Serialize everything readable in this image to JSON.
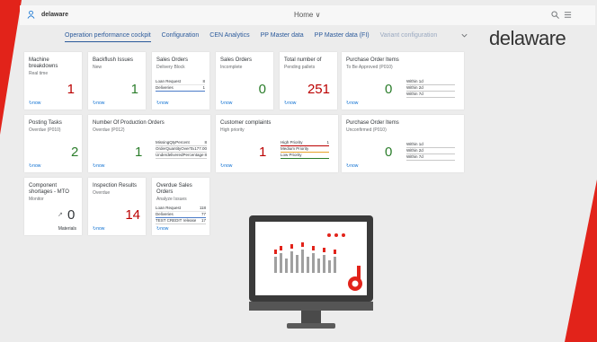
{
  "shell": {
    "brand": "delaware",
    "home_label": "Home ∨",
    "user_icon": "user-icon",
    "search_icon": "search-icon",
    "menu_icon": "menu-icon"
  },
  "tabs": [
    {
      "label": "Operation performance cockpit",
      "active": true
    },
    {
      "label": "Configuration",
      "active": false
    },
    {
      "label": "CEN Analytics",
      "active": false
    },
    {
      "label": "PP Master data",
      "active": false
    },
    {
      "label": "PP Master data (FI)",
      "active": false
    },
    {
      "label": "Variant configuration",
      "active": false
    }
  ],
  "logo": {
    "text": "delaware"
  },
  "colors": {
    "accent": "#e2231a",
    "link": "#0a6ed1",
    "negative": "#bb0000",
    "positive": "#2b7d2b"
  },
  "tiles": {
    "machine": {
      "title": "Machine breakdowns",
      "subtitle": "Real time",
      "value": "1",
      "footer": "now"
    },
    "backflush": {
      "title": "Backflush Issues",
      "subtitle": "New",
      "value": "1",
      "footer": "now"
    },
    "sales_block": {
      "title": "Sales Orders",
      "subtitle": "Delivery Block",
      "footer": "now",
      "rows": [
        {
          "label": "Loan Request",
          "value": "8"
        },
        {
          "label": "Deliveries",
          "value": "1"
        }
      ]
    },
    "sales_incomplete": {
      "title": "Sales Orders",
      "subtitle": "Incomplete",
      "value": "0",
      "footer": "now"
    },
    "pending": {
      "title": "Total number of",
      "subtitle": "Pending pallets",
      "value": "251",
      "footer": "now"
    },
    "po_approval": {
      "title": "Purchase Order Items",
      "subtitle": "To Be Approved (P010)",
      "value": "0",
      "footer": "now",
      "rows": [
        {
          "label": "Within 1d",
          "value": ""
        },
        {
          "label": "Within 2d",
          "value": ""
        },
        {
          "label": "Within 7d",
          "value": ""
        }
      ]
    },
    "posting": {
      "title": "Posting Tasks",
      "subtitle": "Overdue (P010)",
      "value": "2",
      "footer": "now"
    },
    "production": {
      "title": "Number Of Production Orders",
      "subtitle": "Overdue (P012)",
      "value": "1",
      "footer": "now",
      "rows": [
        {
          "label": "MissingQtyPercent",
          "value": "8"
        },
        {
          "label": "OrderQuantityOverTargetQty",
          "value": "177.00"
        },
        {
          "label": "UnderdeliveredPercentage",
          "value": "8"
        }
      ]
    },
    "complaints": {
      "title": "Customer complaints",
      "subtitle": "High priority",
      "value": "1",
      "footer": "now",
      "rows": [
        {
          "label": "High Priority",
          "value": "1"
        },
        {
          "label": "Medium Priority",
          "value": ""
        },
        {
          "label": "Low Priority",
          "value": ""
        }
      ]
    },
    "po_unconfirmed": {
      "title": "Purchase Order Items",
      "subtitle": "Unconfirmed (P010)",
      "value": "0",
      "footer": "now",
      "rows": [
        {
          "label": "Within 1d",
          "value": ""
        },
        {
          "label": "Within 2d",
          "value": ""
        },
        {
          "label": "Within 7d",
          "value": ""
        }
      ]
    },
    "shortages": {
      "title": "Component shortages - MTO",
      "subtitle": "Monitor",
      "value": "0",
      "unit": "Materials"
    },
    "inspection": {
      "title": "Inspection Results",
      "subtitle": "Overdue",
      "value": "14",
      "footer": "now"
    },
    "overdue_sales": {
      "title": "Overdue Sales Orders",
      "subtitle": "Analyze Issues",
      "footer": "now",
      "rows": [
        {
          "label": "Loan Request",
          "value": "118"
        },
        {
          "label": "Deliveries",
          "value": "77"
        },
        {
          "label": "TEST CREDIT release",
          "value": "17"
        }
      ]
    }
  }
}
